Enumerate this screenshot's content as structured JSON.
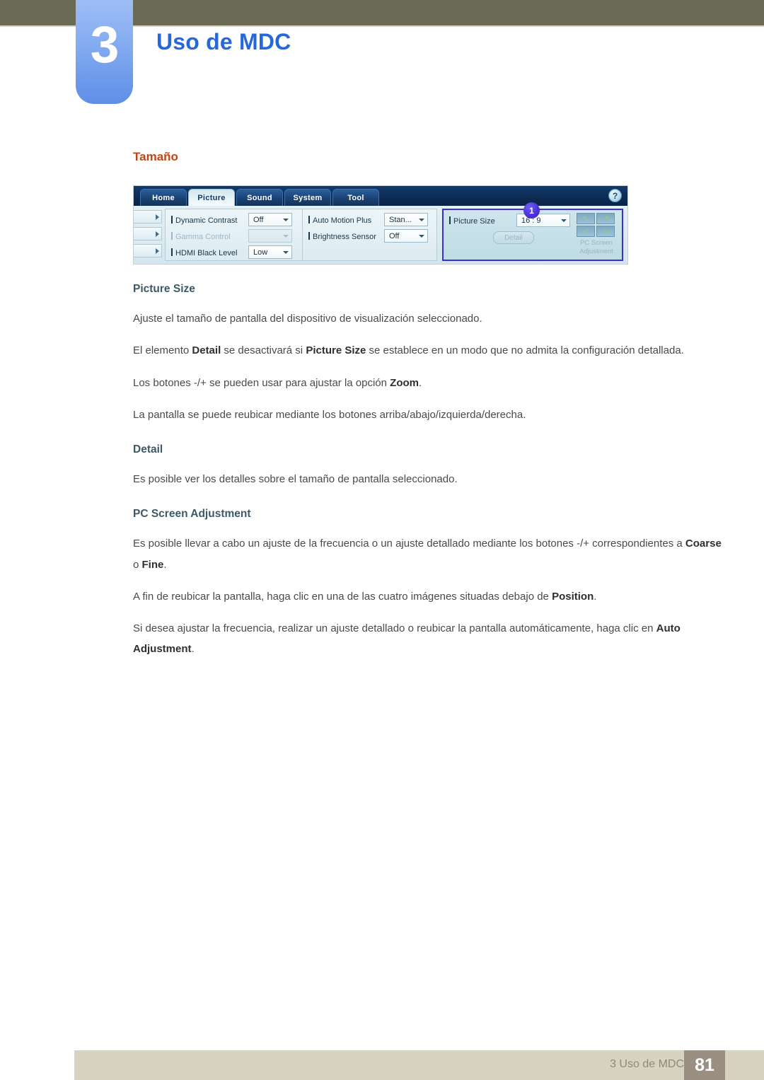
{
  "header": {
    "chapter_number": "3",
    "chapter_title": "Uso de MDC",
    "accent_color": "#2667d9",
    "bar_color": "#6b6a55"
  },
  "content": {
    "section_title": "Tamaño",
    "section_title_color": "#c04516"
  },
  "mdc_screenshot": {
    "tabs": [
      {
        "label": "Home",
        "active": false
      },
      {
        "label": "Picture",
        "active": true
      },
      {
        "label": "Sound",
        "active": false
      },
      {
        "label": "System",
        "active": false
      },
      {
        "label": "Tool",
        "active": false
      }
    ],
    "help_button": "?",
    "column_a": [
      {
        "label": "Dynamic Contrast",
        "value": "Off",
        "disabled": false
      },
      {
        "label": "Gamma Control",
        "value": "",
        "disabled": true
      },
      {
        "label": "HDMI Black Level",
        "value": "Low",
        "disabled": false
      }
    ],
    "column_b": [
      {
        "label": "Auto Motion Plus",
        "value": "Stan...",
        "disabled": false
      },
      {
        "label": "Brightness Sensor",
        "value": "Off",
        "disabled": false
      }
    ],
    "column_c": {
      "callout_badge": "1",
      "picture_size_label": "Picture Size",
      "picture_size_value": "16 : 9",
      "detail_button": "Detail",
      "pc_screen_label_line1": "PC Screen",
      "pc_screen_label_line2": "Adjustment",
      "arrow_glyphs": [
        "↖",
        "↗",
        "↙",
        "↘"
      ],
      "highlight_color": "#3b2fd0"
    }
  },
  "sections": [
    {
      "heading": "Picture Size",
      "paragraphs": [
        {
          "parts": [
            {
              "t": "Ajuste el tamaño de pantalla del dispositivo de visualización seleccionado.",
              "b": false
            }
          ]
        },
        {
          "parts": [
            {
              "t": "El elemento ",
              "b": false
            },
            {
              "t": "Detail",
              "b": true
            },
            {
              "t": " se desactivará si ",
              "b": false
            },
            {
              "t": "Picture Size",
              "b": true
            },
            {
              "t": " se establece en un modo que no admita la configuración detallada.",
              "b": false
            }
          ]
        },
        {
          "parts": [
            {
              "t": "Los botones -/+ se pueden usar para ajustar la opción ",
              "b": false
            },
            {
              "t": "Zoom",
              "b": true
            },
            {
              "t": ".",
              "b": false
            }
          ]
        },
        {
          "parts": [
            {
              "t": "La pantalla se puede reubicar mediante los botones arriba/abajo/izquierda/derecha.",
              "b": false
            }
          ]
        }
      ]
    },
    {
      "heading": "Detail",
      "paragraphs": [
        {
          "parts": [
            {
              "t": "Es posible ver los detalles sobre el tamaño de pantalla seleccionado.",
              "b": false
            }
          ]
        }
      ]
    },
    {
      "heading": "PC Screen Adjustment",
      "paragraphs": [
        {
          "parts": [
            {
              "t": "Es posible llevar a cabo un ajuste de la frecuencia o un ajuste detallado mediante los botones -/+ correspondientes a ",
              "b": false
            },
            {
              "t": "Coarse",
              "b": true
            },
            {
              "t": " o ",
              "b": false
            },
            {
              "t": "Fine",
              "b": true
            },
            {
              "t": ".",
              "b": false
            }
          ]
        },
        {
          "parts": [
            {
              "t": "A fin de reubicar la pantalla, haga clic en una de las cuatro imágenes situadas debajo de ",
              "b": false
            },
            {
              "t": "Position",
              "b": true
            },
            {
              "t": ".",
              "b": false
            }
          ]
        },
        {
          "parts": [
            {
              "t": "Si desea ajustar la frecuencia, realizar un ajuste detallado o reubicar la pantalla automáticamente, haga clic en ",
              "b": false
            },
            {
              "t": "Auto Adjustment",
              "b": true
            },
            {
              "t": ".",
              "b": false
            }
          ]
        }
      ]
    }
  ],
  "footer": {
    "text": "3 Uso de MDC",
    "page_number": "81",
    "band_color": "#d8d3c0",
    "page_box_color": "#9a8f82"
  }
}
